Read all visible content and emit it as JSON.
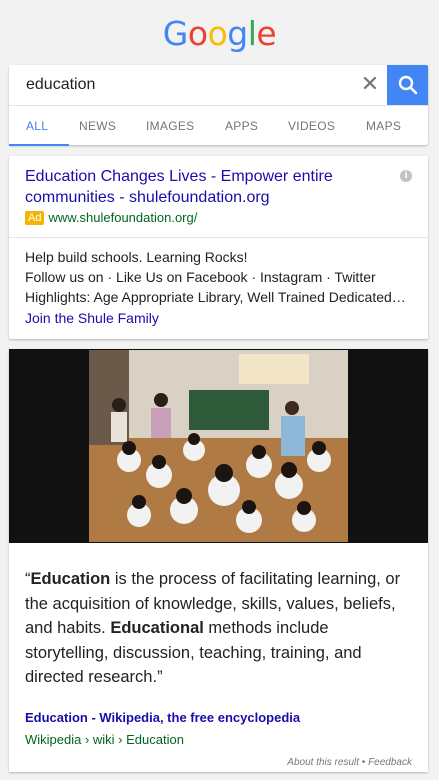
{
  "logo": {
    "letters": [
      "G",
      "o",
      "o",
      "g",
      "l",
      "e"
    ],
    "colors": [
      "#4285f4",
      "#ea4335",
      "#fbbc05",
      "#4285f4",
      "#34a853",
      "#ea4335"
    ]
  },
  "search": {
    "value": "education",
    "clear_icon": "clear-icon",
    "search_icon": "search-icon",
    "button_color": "#4285f4"
  },
  "tabs": [
    {
      "label": "ALL",
      "active": true
    },
    {
      "label": "NEWS"
    },
    {
      "label": "IMAGES"
    },
    {
      "label": "APPS"
    },
    {
      "label": "VIDEOS"
    },
    {
      "label": "MAPS"
    }
  ],
  "ad": {
    "title_line1": "Education Changes Lives - Empower entire",
    "title_line2": "communities - shulefoundation.org",
    "badge": "Ad",
    "url": "www.shulefoundation.org/",
    "line1": "Help build schools. Learning Rocks!",
    "line2": "Follow us on · Like Us on Facebook · Instagram · Twitter",
    "line3": "Highlights: Age Appropriate Library, Well Trained Dedicated…",
    "link": "Join the Shule Family"
  },
  "knowledge": {
    "quote_open": "“",
    "term1": "Education",
    "text1": " is the process of facilitating learning, or the acquisition of knowledge, skills, values, beliefs, and habits. ",
    "term2": "Educational",
    "text2": " methods include storytelling, discussion, teaching, training, and directed research.",
    "quote_close": "”",
    "source_title": "Education - Wikipedia, the free encyclopedia",
    "source_url": "Wikipedia › wiki › Education",
    "about": "About this result",
    "sep": " • ",
    "feedback": "Feedback"
  }
}
